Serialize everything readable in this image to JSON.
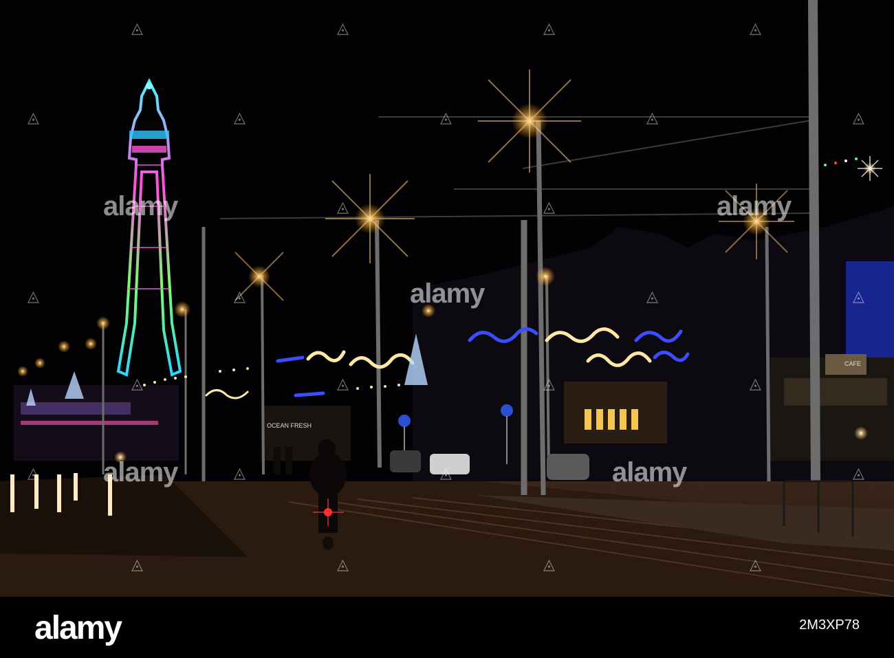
{
  "photo": {
    "watermark_text": "alamy",
    "stock_logo": "alamy",
    "image_id": "2M3XP78",
    "sign_ocean_fresh": "OCEAN FRESH",
    "sign_cafe": "CAFE",
    "watermark_icon": "alamy-a-icon"
  },
  "colors": {
    "sky": "#020204",
    "street_glow": "#ffb347",
    "tower_cyan": "#34f5ff",
    "tower_magenta": "#ff3fd1",
    "tower_green": "#4dff7a",
    "lights_blue": "#3a4dff",
    "lights_warm": "#ffe7a8"
  }
}
